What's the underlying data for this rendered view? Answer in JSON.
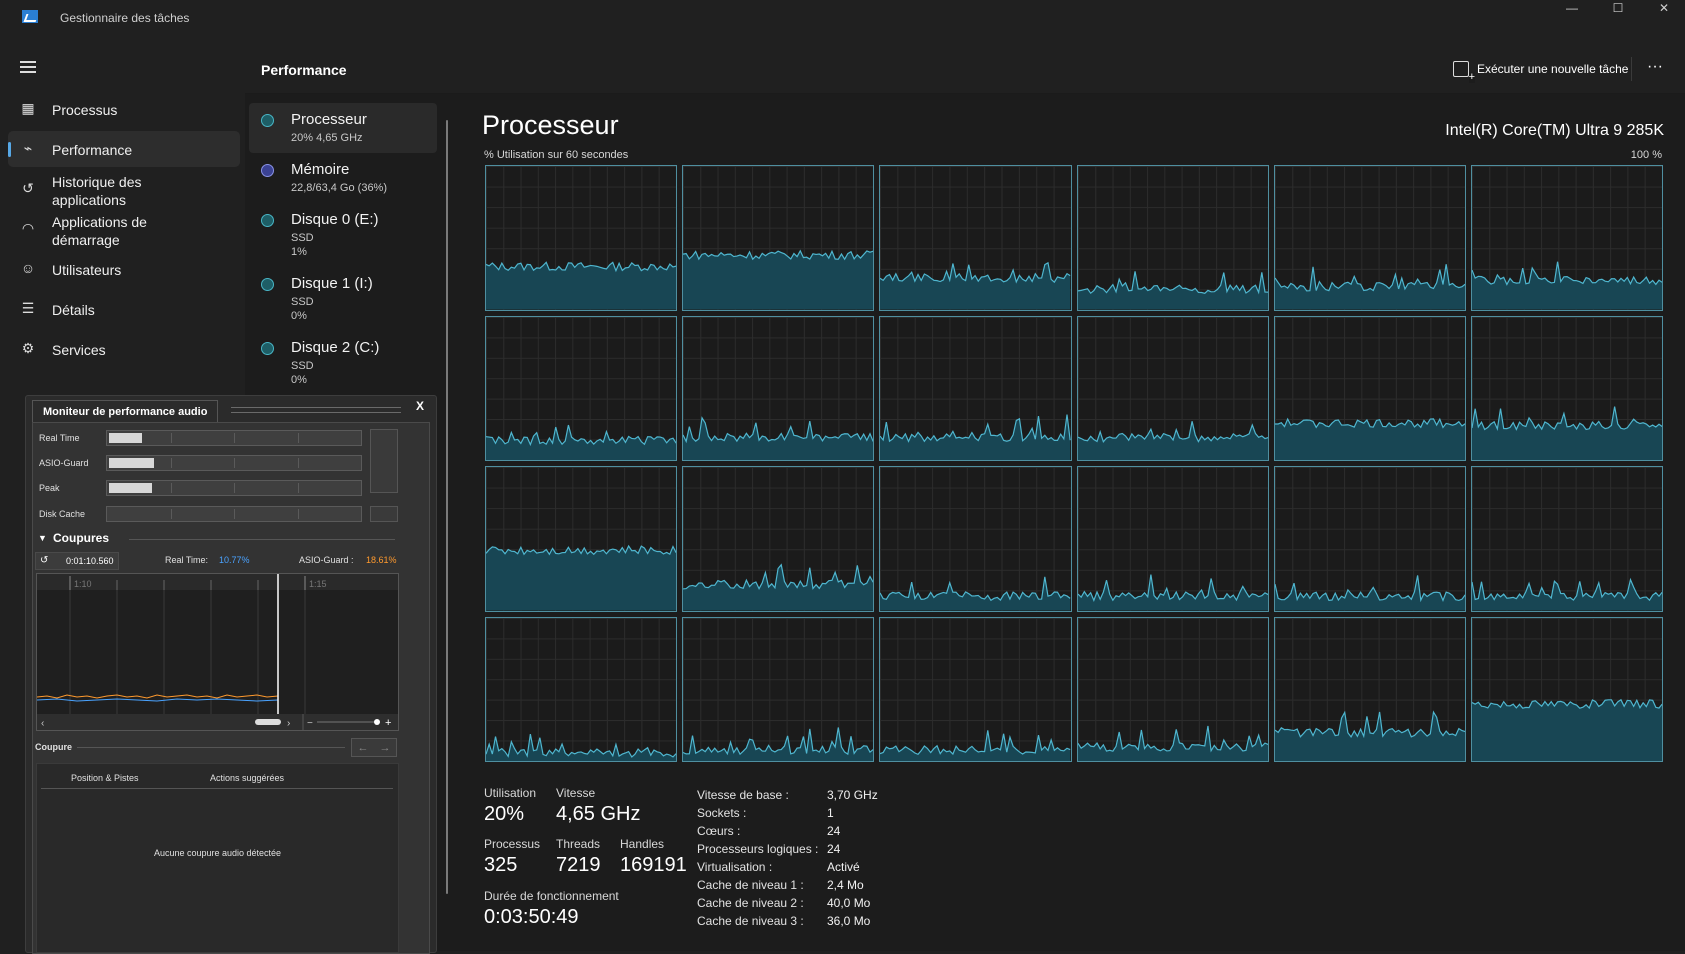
{
  "window": {
    "title": "Gestionnaire des tâches",
    "min": "—",
    "max": "☐",
    "close": "✕"
  },
  "nav": {
    "items": [
      {
        "label": "Processus",
        "icon": "processes-icon"
      },
      {
        "label": "Performance",
        "icon": "performance-icon"
      },
      {
        "label": "Historique des\napplications",
        "icon": "history-icon"
      },
      {
        "label": "Applications de\ndémarrage",
        "icon": "startup-icon"
      },
      {
        "label": "Utilisateurs",
        "icon": "users-icon"
      },
      {
        "label": "Détails",
        "icon": "details-icon"
      },
      {
        "label": "Services",
        "icon": "services-icon"
      }
    ]
  },
  "header": {
    "title": "Performance",
    "run_task": "Exécuter une nouvelle tâche",
    "more": "···"
  },
  "devices": [
    {
      "name": "Processeur",
      "sub1": "20% 4,65 GHz",
      "sub2": "",
      "color": "#49b6c6"
    },
    {
      "name": "Mémoire",
      "sub1": "22,8/63,4 Go (36%)",
      "sub2": "",
      "color": "#8a93e6"
    },
    {
      "name": "Disque 0 (E:)",
      "sub1": "SSD",
      "sub2": "1%",
      "color": "#49b6c6"
    },
    {
      "name": "Disque 1 (I:)",
      "sub1": "SSD",
      "sub2": "0%",
      "color": "#49b6c6"
    },
    {
      "name": "Disque 2 (C:)",
      "sub1": "SSD",
      "sub2": "0%",
      "color": "#49b6c6"
    }
  ],
  "cpu": {
    "title": "Processeur",
    "model": "Intel(R) Core(TM) Ultra 9 285K",
    "util_label": "% Utilisation sur 60 secondes",
    "util_max": "100 %",
    "core_levels": [
      30,
      38,
      22,
      14,
      16,
      20,
      14,
      16,
      16,
      16,
      26,
      24,
      42,
      18,
      10,
      10,
      10,
      10,
      6,
      8,
      8,
      10,
      20,
      40
    ],
    "stats": {
      "utilisation_label": "Utilisation",
      "utilisation": "20%",
      "vitesse_label": "Vitesse",
      "vitesse": "4,65 GHz",
      "processus_label": "Processus",
      "processus": "325",
      "threads_label": "Threads",
      "threads": "7219",
      "handles_label": "Handles",
      "handles": "169191",
      "uptime_label": "Durée de fonctionnement",
      "uptime": "0:03:50:49"
    },
    "specs": [
      {
        "label": "Vitesse de base :",
        "value": "3,70 GHz"
      },
      {
        "label": "Sockets :",
        "value": "1"
      },
      {
        "label": "Cœurs :",
        "value": "24"
      },
      {
        "label": "Processeurs logiques :",
        "value": "24"
      },
      {
        "label": "Virtualisation :",
        "value": "Activé"
      },
      {
        "label": "Cache de niveau 1 :",
        "value": "2,4 Mo"
      },
      {
        "label": "Cache de niveau 2 :",
        "value": "40,0 Mo"
      },
      {
        "label": "Cache de niveau 3 :",
        "value": "36,0 Mo"
      }
    ]
  },
  "audio": {
    "tab": "Moniteur de performance audio",
    "close": "X",
    "meters": [
      {
        "label": "Real Time",
        "level": 0.13
      },
      {
        "label": "ASIO-Guard",
        "level": 0.18
      },
      {
        "label": "Peak",
        "level": 0.17
      },
      {
        "label": "Disk Cache",
        "level": 0
      }
    ],
    "section": "Coupures",
    "time": "0:01:10.560",
    "realtime_label": "Real Time:",
    "realtime_value": "10.77%",
    "asio_label": "ASIO-Guard :",
    "asio_value": "18.61%",
    "realtime_color": "#4aa3ff",
    "asio_color": "#ff9a2e",
    "ruler": [
      "1:10",
      "1:15"
    ],
    "coupure_title": "Coupure",
    "col1": "Position & Pistes",
    "col2": "Actions suggérées",
    "empty": "Aucune coupure audio détectée"
  }
}
